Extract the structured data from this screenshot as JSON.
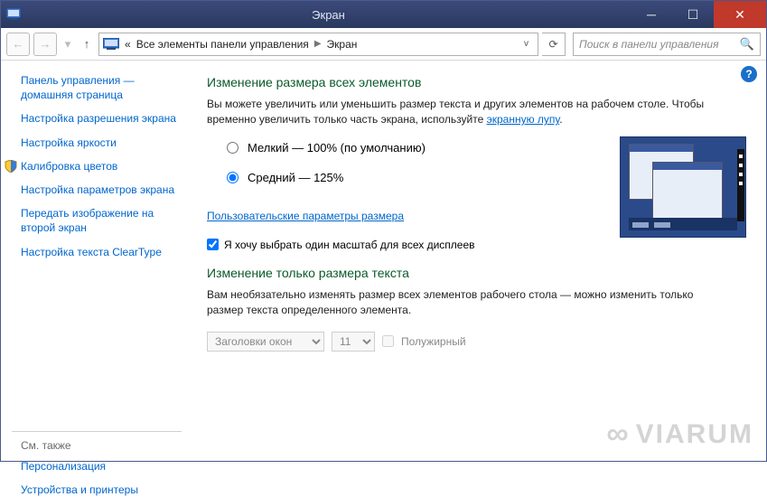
{
  "window": {
    "title": "Экран"
  },
  "addressbar": {
    "prefix": "«",
    "crumb1": "Все элементы панели управления",
    "crumb2": "Экран"
  },
  "search": {
    "placeholder": "Поиск в панели управления"
  },
  "sidebar": {
    "home": "Панель управления — домашняя страница",
    "items": [
      "Настройка разрешения экрана",
      "Настройка яркости",
      "Калибровка цветов",
      "Настройка параметров экрана",
      "Передать изображение на второй экран",
      "Настройка текста ClearType"
    ],
    "see_also_label": "См. также",
    "see_also": [
      "Персонализация",
      "Устройства и принтеры"
    ]
  },
  "main": {
    "heading1": "Изменение размера всех элементов",
    "desc1a": "Вы можете увеличить или уменьшить размер текста и других элементов на рабочем столе. Чтобы временно увеличить только часть экрана, используйте ",
    "desc1_link": "экранную лупу",
    "radio_small": "Мелкий — 100% (по умолчанию)",
    "radio_medium": "Средний — 125%",
    "custom_link": "Пользовательские параметры размера",
    "checkbox_label": "Я хочу выбрать один масштаб для всех дисплеев",
    "heading2": "Изменение только размера текста",
    "desc2": "Вам необязательно изменять размер всех элементов рабочего стола — можно изменить только размер текста определенного элемента.",
    "dropdown_item": "Заголовки окон",
    "dropdown_size": "11",
    "bold_label": "Полужирный"
  },
  "watermark": "VIARUM"
}
